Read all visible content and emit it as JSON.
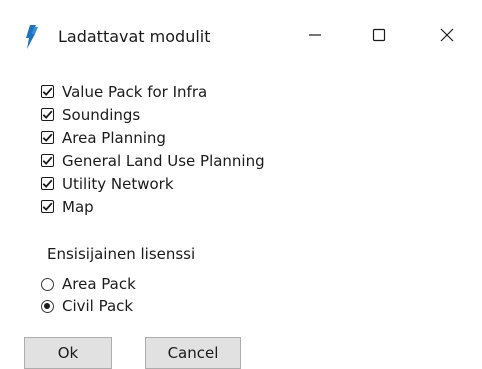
{
  "window": {
    "title": "Ladattavat modulit",
    "app_icon": "lightning-icon",
    "accent_color": "#1e73be",
    "controls": {
      "minimize_icon": "minimize-icon",
      "maximize_icon": "maximize-icon",
      "close_icon": "close-icon"
    }
  },
  "modules": [
    {
      "label": "Value Pack for Infra",
      "checked": true
    },
    {
      "label": "Soundings",
      "checked": true
    },
    {
      "label": "Area Planning",
      "checked": true
    },
    {
      "label": "General Land Use Planning",
      "checked": true
    },
    {
      "label": "Utility Network",
      "checked": true
    },
    {
      "label": "Map",
      "checked": true
    }
  ],
  "license": {
    "group_label": "Ensisijainen lisenssi",
    "options": [
      {
        "label": "Area Pack",
        "selected": false
      },
      {
        "label": "Civil Pack",
        "selected": true
      }
    ]
  },
  "buttons": {
    "ok": "Ok",
    "cancel": "Cancel"
  }
}
